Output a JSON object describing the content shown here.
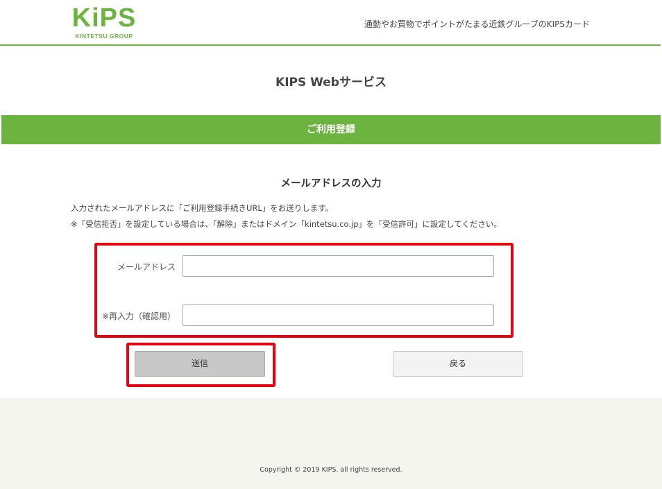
{
  "header": {
    "logo_text": "KiPS",
    "logo_sub": "KINTETSU GROUP",
    "tagline": "通勤やお買物でポイントがたまる近鉄グループのKIPSカード"
  },
  "page": {
    "service_title": "KIPS Webサービス",
    "bar_title": "ご利用登録",
    "section_title": "メールアドレスの入力",
    "notice_1": "入力されたメールアドレスに「ご利用登録手続きURL」をお送りします。",
    "notice_2": "※「受信拒否」を設定している場合は、「解除」またはドメイン「kintetsu.co.jp」を「受信許可」に設定してください。"
  },
  "form": {
    "email_label": "メールアドレス",
    "email_value": "",
    "confirm_label": "※再入力（確認用）",
    "confirm_value": "",
    "submit_label": "送信",
    "back_label": "戻る"
  },
  "footer": {
    "copyright": "Copyright © 2019 KIPS. all rights reserved."
  },
  "colors": {
    "brand_green": "#6db33f",
    "highlight_red": "#e60012"
  }
}
